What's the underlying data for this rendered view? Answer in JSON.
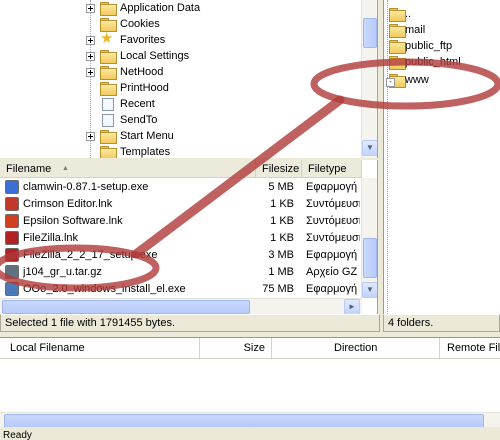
{
  "local_tree": {
    "items": [
      {
        "label": "Application Data",
        "expandable": true,
        "icon": "folder-icon"
      },
      {
        "label": "Cookies",
        "expandable": false,
        "icon": "folder-icon"
      },
      {
        "label": "Favorites",
        "expandable": true,
        "icon": "favorites-star-icon"
      },
      {
        "label": "Local Settings",
        "expandable": true,
        "icon": "folder-icon"
      },
      {
        "label": "NetHood",
        "expandable": true,
        "icon": "folder-icon"
      },
      {
        "label": "PrintHood",
        "expandable": false,
        "icon": "folder-icon"
      },
      {
        "label": "Recent",
        "expandable": false,
        "icon": "recent-icon"
      },
      {
        "label": "SendTo",
        "expandable": false,
        "icon": "sendto-icon"
      },
      {
        "label": "Start Menu",
        "expandable": true,
        "icon": "folder-icon"
      },
      {
        "label": "Templates",
        "expandable": false,
        "icon": "folder-icon"
      }
    ]
  },
  "remote_tree": {
    "items": [
      {
        "label": ".."
      },
      {
        "label": "mail"
      },
      {
        "label": "public_ftp"
      },
      {
        "label": "public_html"
      },
      {
        "label": "www"
      }
    ]
  },
  "local_list": {
    "columns": {
      "filename": "Filename",
      "sort_indicator": "▲",
      "filesize": "Filesize",
      "filetype": "Filetype"
    },
    "rows": [
      {
        "name": "clamwin-0.87.1-setup.exe",
        "size": "5 MB",
        "type": "Εφαρμογή",
        "icon": "installer-icon",
        "color": "#3a6fd8"
      },
      {
        "name": "Crimson Editor.lnk",
        "size": "1 KB",
        "type": "Συντόμευση",
        "icon": "crimson-editor-icon",
        "color": "#c0392b"
      },
      {
        "name": "Epsilon Software.lnk",
        "size": "1 KB",
        "type": "Συντόμευση",
        "icon": "epsilon-icon",
        "color": "#d04020"
      },
      {
        "name": "FileZilla.lnk",
        "size": "1 KB",
        "type": "Συντόμευση",
        "icon": "filezilla-icon",
        "color": "#b22222"
      },
      {
        "name": "FileZilla_2_2_17_setup.exe",
        "size": "3 MB",
        "type": "Εφαρμογή",
        "icon": "filezilla-icon",
        "color": "#b22222"
      },
      {
        "name": "j104_gr_u.tar.gz",
        "size": "1 MB",
        "type": "Αρχείο GZ",
        "icon": "archive-icon",
        "color": "#607080"
      },
      {
        "name": "OOo_2.0_windows_install_el.exe",
        "size": "75 MB",
        "type": "Εφαρμογή",
        "icon": "openoffice-icon",
        "color": "#4a7ab8"
      }
    ]
  },
  "local_status": "Selected 1 file with 1791455 bytes.",
  "remote_status": "4 folders.",
  "queue": {
    "columns": {
      "local": "Local Filename",
      "size": "Size",
      "direction": "Direction",
      "remote": "Remote File"
    }
  },
  "statusbar": "Ready",
  "annotation_color": "#b03a3a"
}
